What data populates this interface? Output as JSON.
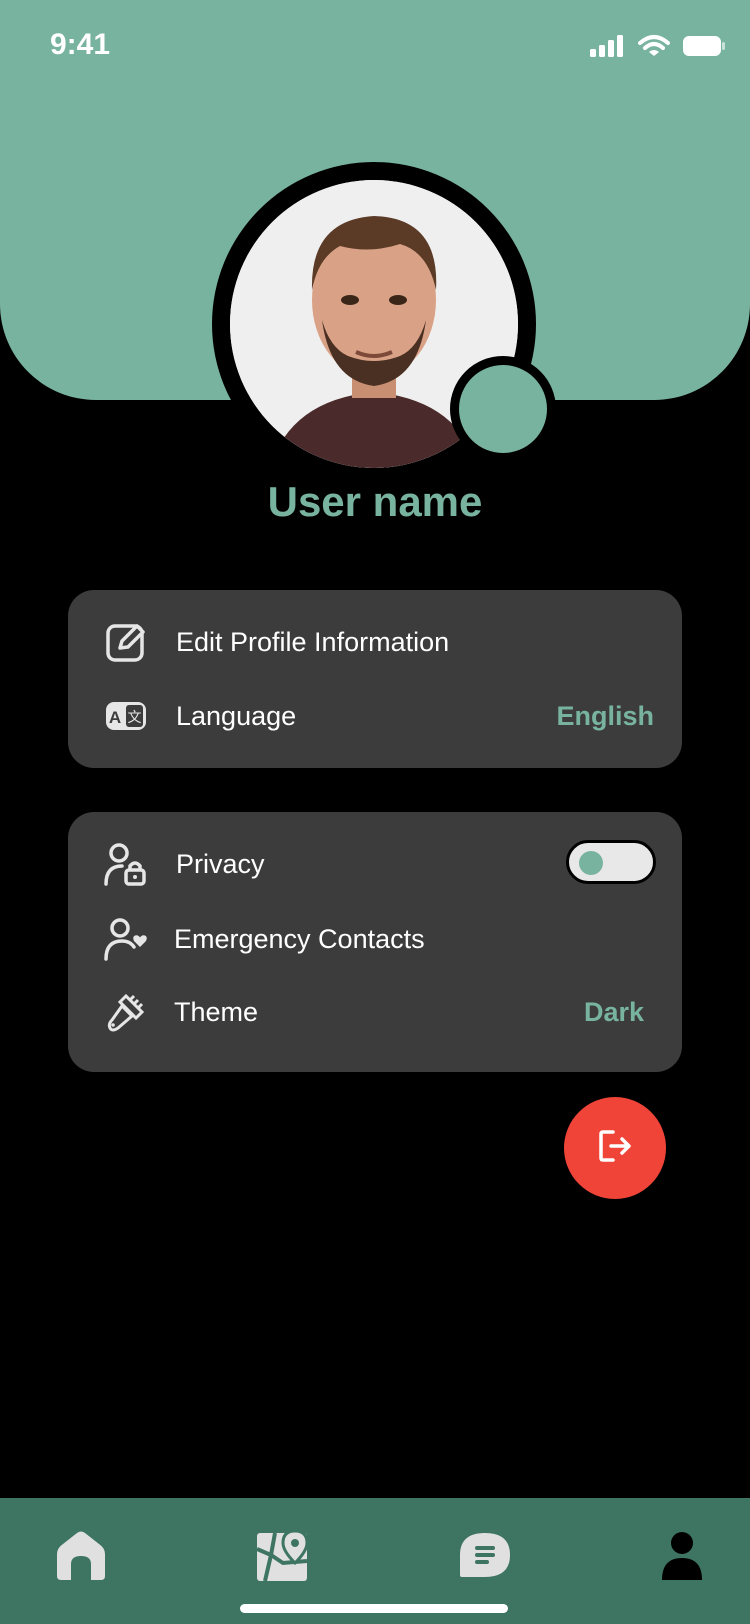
{
  "status_bar": {
    "time": "9:41"
  },
  "profile": {
    "user_name": "User name"
  },
  "card_account": {
    "edit_profile_label": "Edit Profile Information",
    "language_label": "Language",
    "language_value": "English"
  },
  "card_settings": {
    "privacy_label": "Privacy",
    "privacy_toggle_on": false,
    "emergency_contacts_label": "Emergency Contacts",
    "theme_label": "Theme",
    "theme_value": "Dark"
  },
  "bottom_nav": {
    "items": [
      "home-icon",
      "map-pin-icon",
      "chat-icon",
      "profile-icon"
    ],
    "active": "profile-icon"
  },
  "colors": {
    "accent": "#78b3a0",
    "nav_bg": "#3d7562",
    "card_bg": "#3c3c3c",
    "logout": "#f04438"
  }
}
